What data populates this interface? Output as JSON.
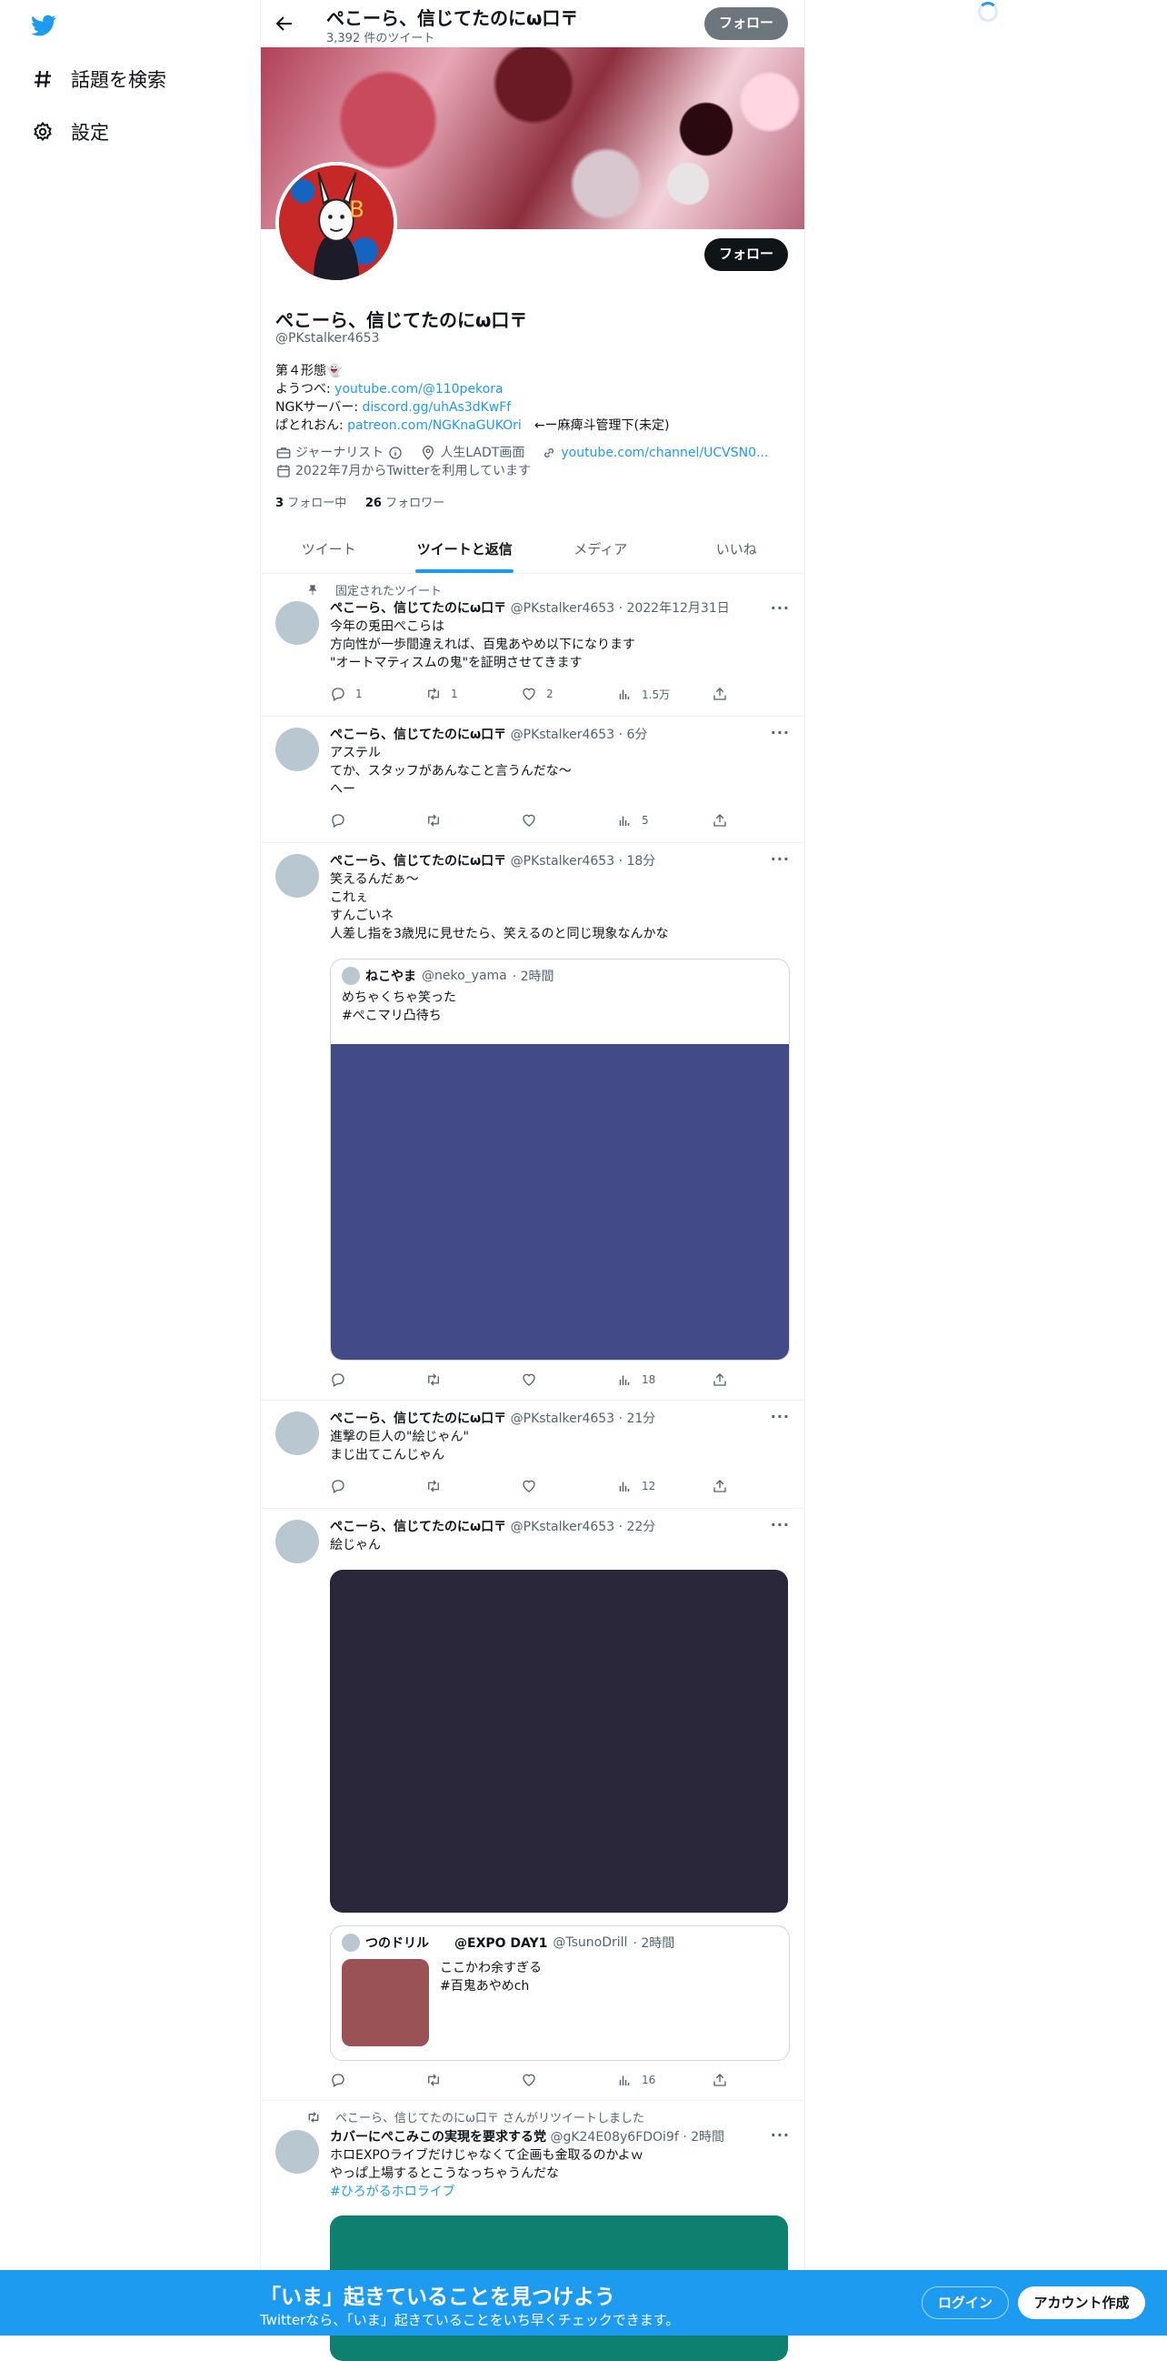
{
  "nav": {
    "explore_label": "話題を検索",
    "settings_label": "設定"
  },
  "header": {
    "name": "ぺこーら、信じてたのにω口〒",
    "tweet_count": "3,392 件のツイート",
    "follow_label": "フォロー"
  },
  "profile": {
    "name": "ぺこーら、信じてたのにω口〒",
    "handle": "@PKstalker4653",
    "follow_label": "フォロー",
    "bio": {
      "line1": "第４形態👻",
      "youtube_prefix": "ようつべ: ",
      "youtube_link": "youtube.com/@110pekora",
      "ngk_prefix": "NGKサーバー: ",
      "ngk_link": "discord.gg/uhAs3dKwFf",
      "patreon_prefix": "ぱとれおん: ",
      "patreon_link": "patreon.com/NGKnaGUKOri",
      "patreon_suffix": "　←ー麻痺斗管理下(未定)"
    },
    "category": "ジャーナリスト",
    "location": "人生LADT画面",
    "url": "youtube.com/channel/UCVSN0...",
    "joined": "2022年7月からTwitterを利用しています",
    "following_count": "3",
    "following_label": "フォロー中",
    "followers_count": "26",
    "followers_label": "フォロワー"
  },
  "tabs": [
    {
      "label": "ツイート",
      "active": false
    },
    {
      "label": "ツイートと返信",
      "active": true
    },
    {
      "label": "メディア",
      "active": false
    },
    {
      "label": "いいね",
      "active": false
    }
  ],
  "tweets": [
    {
      "pinned_label": "固定されたツイート",
      "name": "ぺこーら、信じてたのにω口〒",
      "handle": "@PKstalker4653",
      "time": "· 2022年12月31日",
      "lines": [
        "今年の兎田ぺこらは",
        "方向性が一歩間違えれば、百鬼あやめ以下になります",
        "\"オートマティスムの鬼\"を証明させてきます"
      ],
      "replies": "1",
      "retweets": "1",
      "likes": "2",
      "views": "1.5万"
    },
    {
      "name": "ぺこーら、信じてたのにω口〒",
      "handle": "@PKstalker4653",
      "time": "· 6分",
      "lines": [
        "アステル",
        "てか、スタッフがあんなこと言うんだな〜",
        "へー"
      ],
      "replies": "",
      "retweets": "",
      "likes": "",
      "views": "5"
    },
    {
      "name": "ぺこーら、信じてたのにω口〒",
      "handle": "@PKstalker4653",
      "time": "· 18分",
      "lines": [
        "笑えるんだぁ〜",
        "これぇ",
        "すんごいネ",
        "人差し指を3歳児に見せたら、笑えるのと同じ現象なんかな"
      ],
      "quote": {
        "name": "ねこやま",
        "handle": "@neko_yama",
        "time": "· 2時間",
        "lines": [
          "めちゃくちゃ笑った",
          "#ぺこマリ凸待ち"
        ],
        "media_color": "#434a88"
      },
      "replies": "",
      "retweets": "",
      "likes": "",
      "views": "18"
    },
    {
      "name": "ぺこーら、信じてたのにω口〒",
      "handle": "@PKstalker4653",
      "time": "· 21分",
      "lines": [
        "進撃の巨人の\"絵じゃん\"",
        "まじ出てこんじゃん"
      ],
      "replies": "",
      "retweets": "",
      "likes": "",
      "views": "12"
    },
    {
      "name": "ぺこーら、信じてたのにω口〒",
      "handle": "@PKstalker4653",
      "time": "· 22分",
      "lines": [
        "絵じゃん"
      ],
      "media_color": "#2a273a",
      "quote": {
        "name": "つのドリル　　@EXPO DAY1",
        "handle": "@TsunoDrill",
        "time": "· 2時間",
        "lines": [
          "ここかわ余すぎる",
          "#百鬼あやめch"
        ],
        "thumb_color": "#9a5256"
      },
      "replies": "",
      "retweets": "",
      "likes": "",
      "views": "16"
    },
    {
      "retweeted_label": "ぺこーら、信じてたのにω口〒 さんがリツイートしました",
      "name": "カバーにぺこみこの実現を要求する党",
      "handle": "@gK24E08y6FDOi9f",
      "time": "· 2時間",
      "lines": [
        "ホロEXPOライブだけじゃなくて企画も金取るのかよｗ",
        "やっぱ上場するとこうなっちゃうんだな"
      ],
      "hashtag": "#ひろがるホロライブ",
      "media_color": "#0e8070"
    }
  ],
  "bottom_bar": {
    "title": "「いま」起きていることを見つけよう",
    "subtitle": "Twitterなら、「いま」起きていることをいち早くチェックできます。",
    "login_label": "ログイン",
    "signup_label": "アカウント作成"
  },
  "colors": {
    "accent": "#1d9bf0",
    "text": "#0f1419",
    "secondary": "#536471"
  }
}
